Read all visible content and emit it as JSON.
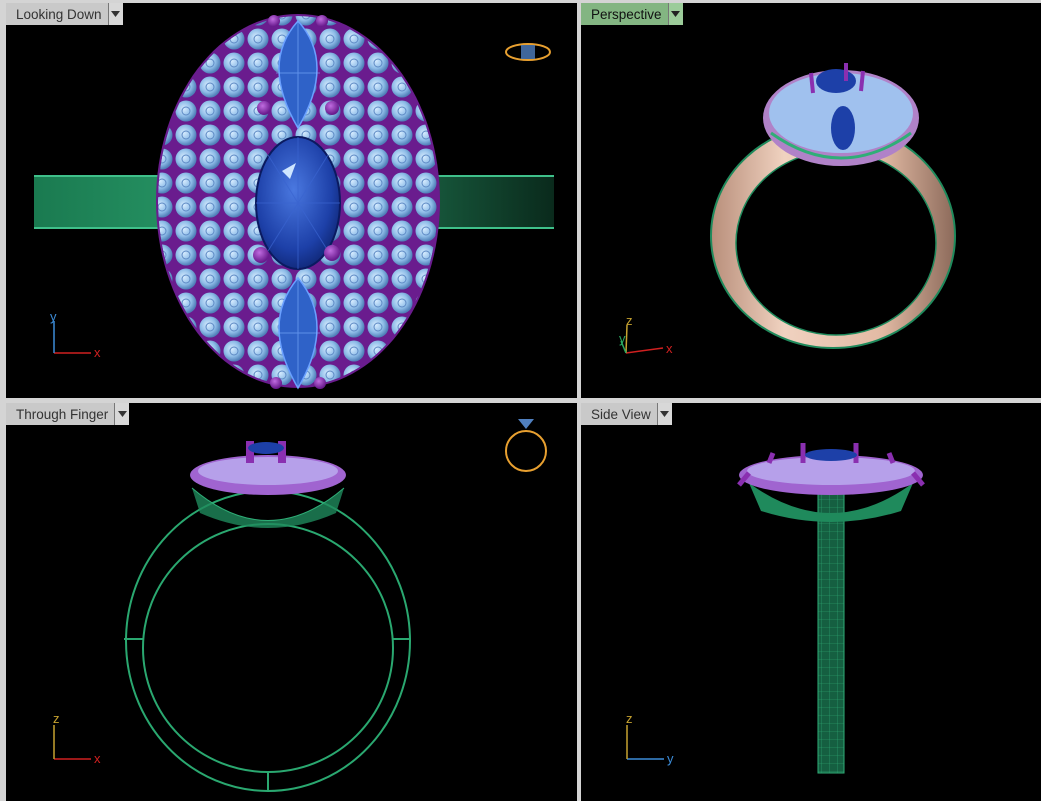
{
  "viewports": {
    "top": {
      "title": "Looking Down"
    },
    "persp": {
      "title": "Perspective"
    },
    "front": {
      "title": "Through Finger"
    },
    "right": {
      "title": "Side View"
    }
  },
  "active_viewport": "Perspective",
  "axes": {
    "top": {
      "vertical": "y",
      "horizontal": "x"
    },
    "persp": {
      "vertical": "z",
      "depth": "y",
      "horizontal": "x"
    },
    "front": {
      "vertical": "z",
      "horizontal": "x"
    },
    "right": {
      "vertical": "z",
      "horizontal": "y"
    }
  },
  "colors": {
    "viewport_bg": "#000000",
    "active_tab": "#83b582",
    "inactive_tab": "#c9c9c9",
    "band_green": "#1f8a5c",
    "wire_green": "#2fae77",
    "prong_purple": "#8a2fb0",
    "diamond_light_blue": "#9fc8f2",
    "sapphire_blue": "#1d40a8",
    "metal_rose": "#e8c3ae",
    "axis_red": "#d02020",
    "axis_green": "#2aa860",
    "axis_blue": "#3c8cd8",
    "axis_yellow": "#c7a330",
    "gizmo_orange": "#e8a030"
  }
}
